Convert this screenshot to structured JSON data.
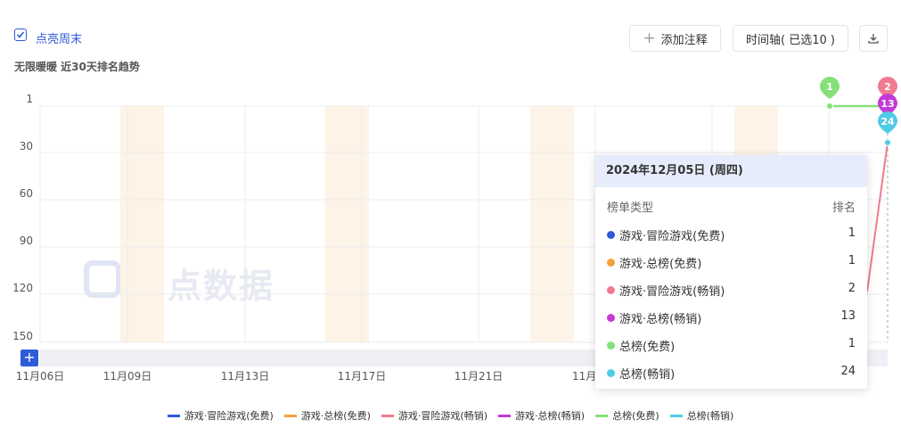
{
  "header": {
    "checkbox_label": "点亮周末",
    "subtitle": "无限暖暖 近30天排名趋势",
    "add_note_label": "添加注释",
    "timeline_label": "时间轴( 已选10 )"
  },
  "watermark": "点点数据",
  "colors": {
    "accent": "#2f5bd9",
    "weekend_band": "#fdf3e6"
  },
  "chart_data": {
    "type": "line",
    "x_ticks": [
      "11月06日",
      "11月09日",
      "11月13日",
      "11月17日",
      "11月21日",
      "11月"
    ],
    "y_ticks": [
      "1",
      "30",
      "60",
      "90",
      "120",
      "150"
    ],
    "ylim": [
      1,
      150
    ],
    "y_inverted": true,
    "grid": true,
    "legend_position": "bottom",
    "series": [
      {
        "name": "游戏·冒险游戏(免费)",
        "color": "#2f5bd9",
        "values": [
          1
        ]
      },
      {
        "name": "游戏·总榜(免费)",
        "color": "#f0a23c",
        "values": [
          1
        ]
      },
      {
        "name": "游戏·冒险游戏(畅销)",
        "color": "#f07b8e",
        "values": [
          2
        ]
      },
      {
        "name": "游戏·总榜(畅销)",
        "color": "#c43ad6",
        "values": [
          13
        ]
      },
      {
        "name": "总榜(免费)",
        "color": "#86e07a",
        "values": [
          1
        ]
      },
      {
        "name": "总榜(畅销)",
        "color": "#4fcbe8",
        "values": [
          24
        ]
      }
    ],
    "markers": [
      {
        "label": "1",
        "color": "#86e07a"
      },
      {
        "label": "2",
        "color": "#f07b8e"
      },
      {
        "label": "13",
        "color": "#c43ad6"
      },
      {
        "label": "24",
        "color": "#4fcbe8"
      }
    ]
  },
  "tooltip": {
    "date": "2024年12月05日 (周四)",
    "col_type": "榜单类型",
    "col_rank": "排名",
    "rows": [
      {
        "name": "游戏·冒险游戏(免费)",
        "value": "1",
        "color": "#2f5bd9"
      },
      {
        "name": "游戏·总榜(免费)",
        "value": "1",
        "color": "#f0a23c"
      },
      {
        "name": "游戏·冒险游戏(畅销)",
        "value": "2",
        "color": "#f07b8e"
      },
      {
        "name": "游戏·总榜(畅销)",
        "value": "13",
        "color": "#c43ad6"
      },
      {
        "name": "总榜(免费)",
        "value": "1",
        "color": "#86e07a"
      },
      {
        "name": "总榜(畅销)",
        "value": "24",
        "color": "#4fcbe8"
      }
    ]
  },
  "legend": [
    {
      "label": "游戏·冒险游戏(免费)",
      "color": "#2f5bd9"
    },
    {
      "label": "游戏·总榜(免费)",
      "color": "#f0a23c"
    },
    {
      "label": "游戏·冒险游戏(畅销)",
      "color": "#f07b8e"
    },
    {
      "label": "游戏·总榜(畅销)",
      "color": "#c43ad6"
    },
    {
      "label": "总榜(免费)",
      "color": "#86e07a"
    },
    {
      "label": "总榜(畅销)",
      "color": "#4fcbe8"
    }
  ]
}
